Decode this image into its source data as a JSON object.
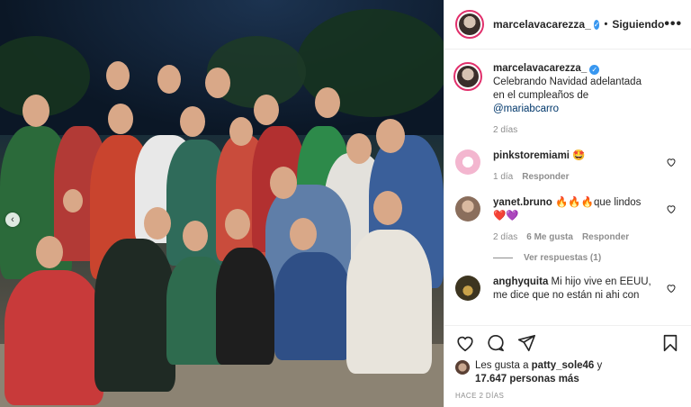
{
  "header": {
    "username": "marcelavacarezza_",
    "separator": "•",
    "follow_status": "Siguiendo",
    "more_glyph": "•••"
  },
  "caption": {
    "username": "marcelavacarezza_",
    "text_before": "Celebrando Navidad adelantada en el cumpleaños de ",
    "mention": "@mariabcarro",
    "age": "2 días"
  },
  "comments": [
    {
      "username": "pinkstoremiami",
      "text": "🤩",
      "age": "1 día",
      "reply_label": "Responder",
      "avatar_color": "#f7d7e4"
    },
    {
      "username": "yanet.bruno",
      "text": "🔥🔥🔥que lindos ❤️💜",
      "age": "2 días",
      "likes": "6 Me gusta",
      "reply_label": "Responder",
      "avatar_color": "#b89a85"
    },
    {
      "username": "anghyquita",
      "text": "Mi hijo vive en EEUU, me dice que no están ni ahi con",
      "avatar_color": "#3d3520"
    }
  ],
  "view_replies": "Ver respuestas (1)",
  "likes": {
    "prefix": "Les gusta a ",
    "user": "patty_sole46",
    "joiner": " y",
    "count": "17.647 personas más"
  },
  "date": "HACE 2 DÍAS",
  "icons": [
    "heart-icon",
    "comment-icon",
    "share-icon",
    "bookmark-icon",
    "verified-icon",
    "more-icon",
    "chevron-left-icon"
  ],
  "colors": {
    "verified": "#3897f0",
    "link": "#00376b",
    "muted": "#8e8e8e"
  }
}
